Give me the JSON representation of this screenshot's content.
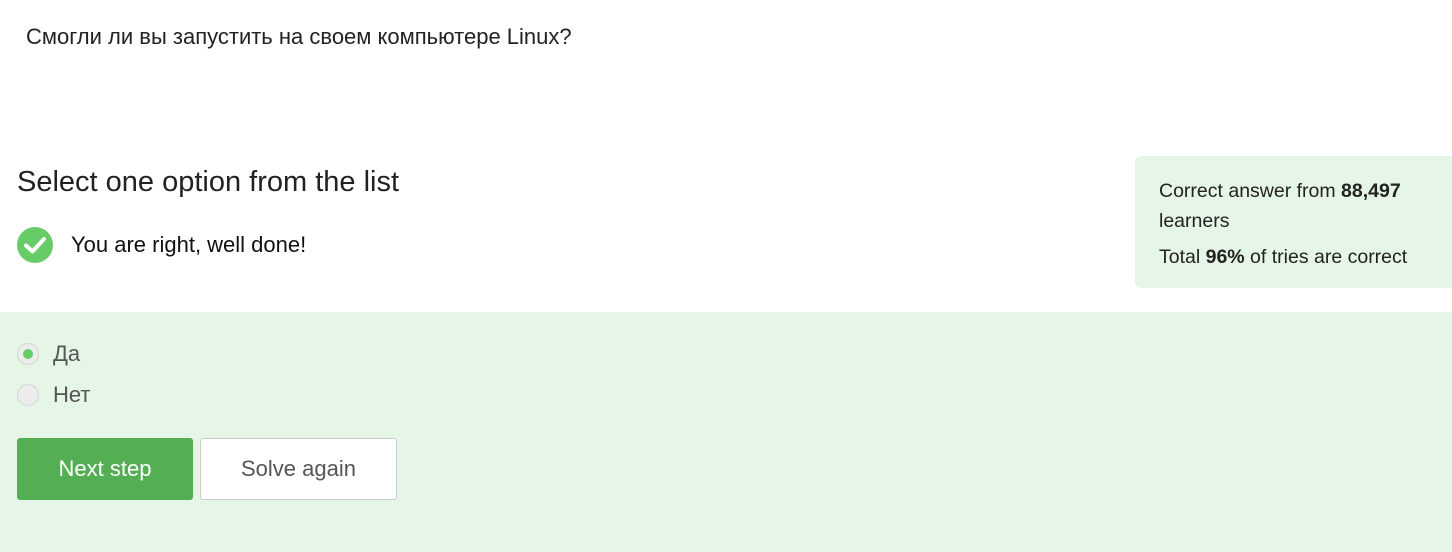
{
  "question": {
    "text": "Смогли ли вы запустить на своем компьютере Linux?"
  },
  "instruction": {
    "text": "Select one option from the list"
  },
  "feedback": {
    "icon": "check-circle-icon",
    "text": "You are right, well done!",
    "color": "#66cc66"
  },
  "stats": {
    "line1_prefix": "Correct answer from ",
    "learners_count": "88,497",
    "line1_suffix": "learners",
    "line2_prefix": "Total ",
    "percent": "96%",
    "line2_suffix": " of tries are correct"
  },
  "options": [
    {
      "label": "Да",
      "selected": true
    },
    {
      "label": "Нет",
      "selected": false
    }
  ],
  "buttons": {
    "next": "Next step",
    "solve_again": "Solve again"
  },
  "colors": {
    "accent": "#54ae54",
    "panel_bg": "#e6f6e6",
    "check": "#66cc66"
  }
}
